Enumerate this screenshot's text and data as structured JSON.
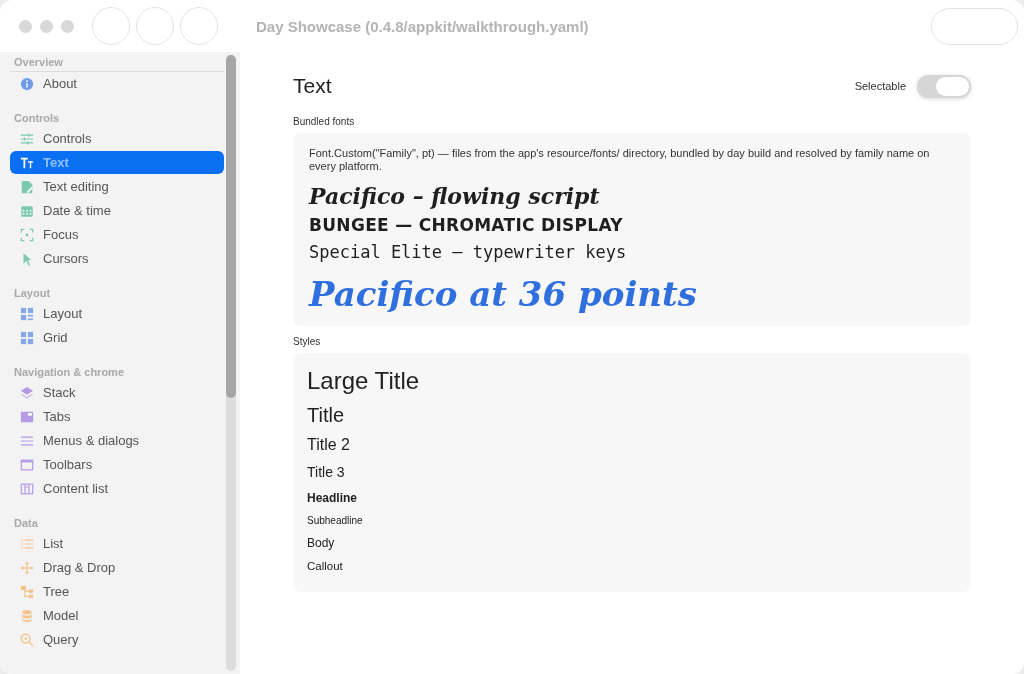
{
  "window": {
    "title": "Day Showcase (0.4.8/appkit/walkthrough.yaml)"
  },
  "sidebar": {
    "sections": [
      {
        "title": "Overview",
        "color": "#6f9be6",
        "items": [
          {
            "label": "About",
            "kind": "info",
            "selected": false
          }
        ]
      },
      {
        "title": "Controls",
        "color": "#7cc9b0",
        "items": [
          {
            "label": "Controls",
            "kind": "sliders",
            "selected": false
          },
          {
            "label": "Text",
            "kind": "text",
            "selected": true
          },
          {
            "label": "Text editing",
            "kind": "doc",
            "selected": false
          },
          {
            "label": "Date & time",
            "kind": "calendar",
            "selected": false
          },
          {
            "label": "Focus",
            "kind": "focus",
            "selected": false
          },
          {
            "label": "Cursors",
            "kind": "pointer",
            "selected": false
          }
        ]
      },
      {
        "title": "Layout",
        "color": "#86a8ea",
        "items": [
          {
            "label": "Layout",
            "kind": "layout",
            "selected": false
          },
          {
            "label": "Grid",
            "kind": "grid",
            "selected": false
          }
        ]
      },
      {
        "title": "Navigation & chrome",
        "color": "#b39be6",
        "items": [
          {
            "label": "Stack",
            "kind": "stack",
            "selected": false
          },
          {
            "label": "Tabs",
            "kind": "tabs",
            "selected": false
          },
          {
            "label": "Menus & dialogs",
            "kind": "lines",
            "selected": false
          },
          {
            "label": "Toolbars",
            "kind": "window",
            "selected": false
          },
          {
            "label": "Content list",
            "kind": "columns",
            "selected": false
          }
        ]
      },
      {
        "title": "Data",
        "color": "#f2c48f",
        "items": [
          {
            "label": "List",
            "kind": "list",
            "selected": false
          },
          {
            "label": "Drag & Drop",
            "kind": "move",
            "selected": false
          },
          {
            "label": "Tree",
            "kind": "tree",
            "selected": false
          },
          {
            "label": "Model",
            "kind": "database",
            "selected": false
          },
          {
            "label": "Query",
            "kind": "search",
            "selected": false
          }
        ]
      }
    ]
  },
  "page": {
    "title": "Text",
    "toggle": {
      "label": "Selectable",
      "on": false
    },
    "fonts": {
      "heading": "Bundled fonts",
      "note": "Font.Custom(\"Family\", pt) — files from the app's resource/fonts/ directory, bundled by day build and resolved by family name on every platform.",
      "samples": [
        {
          "kind": "script",
          "text": "Pacifico – flowing script"
        },
        {
          "kind": "display",
          "text": "BUNGEE — CHROMATIC DISPLAY"
        },
        {
          "kind": "typewriter",
          "text": "Special Elite — typewriter keys"
        },
        {
          "kind": "script-large",
          "text": "Pacifico at 36 points"
        }
      ]
    },
    "styles": {
      "heading": "Styles",
      "samples": [
        {
          "kind": "large-title",
          "text": "Large Title"
        },
        {
          "kind": "title",
          "text": "Title"
        },
        {
          "kind": "title2",
          "text": "Title 2"
        },
        {
          "kind": "title3",
          "text": "Title 3"
        },
        {
          "kind": "headline",
          "text": "Headline"
        },
        {
          "kind": "subheadline",
          "text": "Subheadline"
        },
        {
          "kind": "body",
          "text": "Body"
        },
        {
          "kind": "callout",
          "text": "Callout"
        }
      ]
    }
  }
}
